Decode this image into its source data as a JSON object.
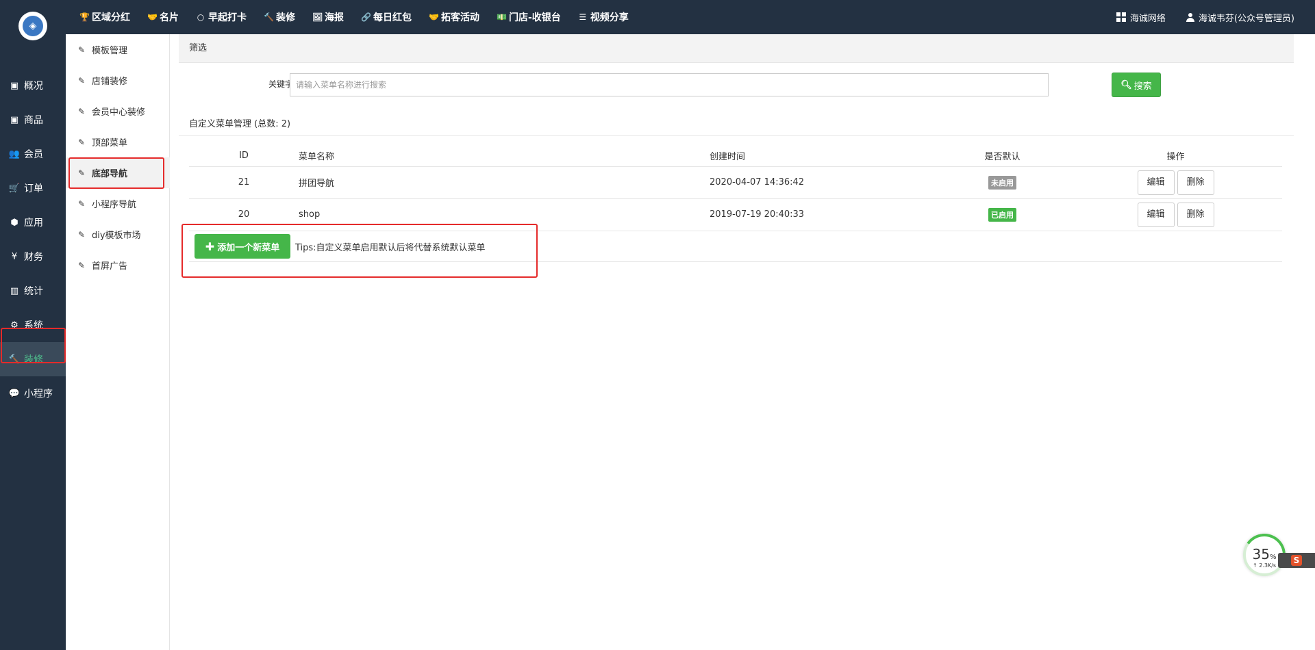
{
  "topbar": {
    "nav": [
      {
        "icon": "trophy-icon",
        "glyph": "🏆",
        "label": "区域分红"
      },
      {
        "icon": "handshake-icon",
        "glyph": "🤝",
        "label": "名片"
      },
      {
        "icon": "circle-icon",
        "glyph": "○",
        "label": "早起打卡"
      },
      {
        "icon": "gavel-icon",
        "glyph": "🔨",
        "label": "装修"
      },
      {
        "icon": "image-icon",
        "glyph": "🖼",
        "label": "海报"
      },
      {
        "icon": "link-icon",
        "glyph": "🔗",
        "label": "每日红包"
      },
      {
        "icon": "handshake-icon",
        "glyph": "🤝",
        "label": "拓客活动"
      },
      {
        "icon": "money-icon",
        "glyph": "💵",
        "label": "门店-收银台"
      },
      {
        "icon": "list-icon",
        "glyph": "☰",
        "label": "视频分享"
      }
    ],
    "right": {
      "company": "海诚网络",
      "user": "海诚韦芬(公众号管理员)"
    }
  },
  "sidebar": {
    "items": [
      {
        "icon": "calendar-icon",
        "glyph": "▣",
        "label": "概况"
      },
      {
        "icon": "box-icon",
        "glyph": "▣",
        "label": "商品"
      },
      {
        "icon": "users-icon",
        "glyph": "👥",
        "label": "会员"
      },
      {
        "icon": "cart-icon",
        "glyph": "🛒",
        "label": "订单"
      },
      {
        "icon": "cubes-icon",
        "glyph": "⬢",
        "label": "应用"
      },
      {
        "icon": "yen-icon",
        "glyph": "¥",
        "label": "财务"
      },
      {
        "icon": "bar-chart-icon",
        "glyph": "▥",
        "label": "统计"
      },
      {
        "icon": "gears-icon",
        "glyph": "⚙",
        "label": "系统"
      },
      {
        "icon": "gavel-icon",
        "glyph": "🔨",
        "label": "装修"
      },
      {
        "icon": "wechat-icon",
        "glyph": "💬",
        "label": "小程序"
      }
    ],
    "active_index": 8
  },
  "submenu": {
    "items": [
      {
        "label": "模板管理"
      },
      {
        "label": "店铺装修"
      },
      {
        "label": "会员中心装修"
      },
      {
        "label": "顶部菜单"
      },
      {
        "label": "底部导航"
      },
      {
        "label": "小程序导航"
      },
      {
        "label": "diy模板市场"
      },
      {
        "label": "首屏广告"
      }
    ],
    "active_index": 4
  },
  "filter": {
    "title": "筛选",
    "keyword_label": "关键字",
    "keyword_placeholder": "请输入菜单名称进行搜索",
    "keyword_value": "",
    "search_button": "搜索"
  },
  "menu_section": {
    "title": "自定义菜单管理 (总数: 2)",
    "columns": {
      "id": "ID",
      "name": "菜单名称",
      "created": "创建时间",
      "default": "是否默认",
      "actions": "操作"
    },
    "rows": [
      {
        "id": "21",
        "name": "拼团导航",
        "created": "2020-04-07 14:36:42",
        "status": "未启用",
        "enabled": false,
        "edit": "编辑",
        "delete": "删除"
      },
      {
        "id": "20",
        "name": "shop",
        "created": "2019-07-19 20:40:33",
        "status": "已启用",
        "enabled": true,
        "edit": "编辑",
        "delete": "删除"
      }
    ],
    "add_button": "添加一个新菜单",
    "tips": "Tips:自定义菜单启用默认后将代替系统默认菜单"
  },
  "speed_widget": {
    "percent": "35",
    "percent_unit": "%",
    "rate": "↑ 2.3K/s"
  },
  "ime_badge": "S",
  "colors": {
    "dark_bg": "#233142",
    "green": "#45b649",
    "highlight_red": "#e52a2a",
    "badge_off": "#999999"
  }
}
